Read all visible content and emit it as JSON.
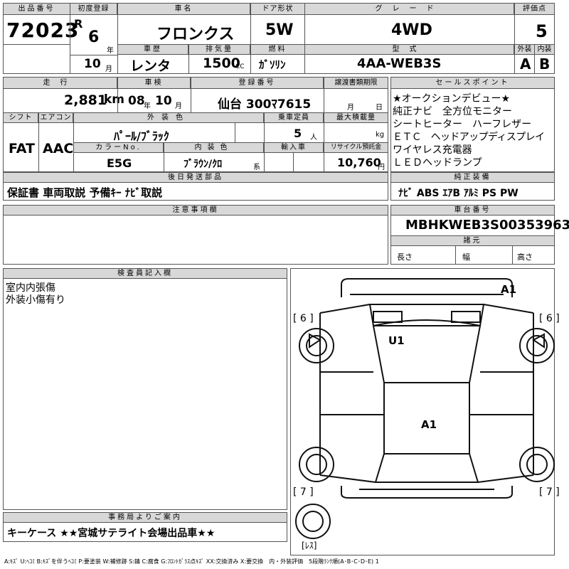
{
  "header": {
    "lot_label": "出品番号",
    "lot_value": "72023",
    "first_reg_label": "初度登録",
    "era": "R",
    "year_num": "6",
    "year_unit": "年",
    "month_num": "10",
    "month_unit": "月",
    "car_name_label": "車名",
    "car_name": "フロンクス",
    "door_label": "ドア形状",
    "door": "5W",
    "grade_label": "グレード",
    "grade": "4WD",
    "score_label": "評価点",
    "score": "5",
    "history_label": "車歴",
    "history": "レンタ",
    "displacement_label": "排気量",
    "displacement": "1500",
    "cc": "CC",
    "fuel_label": "燃料",
    "fuel": "ｶﾞｿﾘﾝ",
    "model_label": "型式",
    "model": "4AA-WEB3S",
    "exterior_label": "外装",
    "exterior": "A",
    "interior_label": "内装",
    "interior": "B"
  },
  "row2": {
    "mileage_label": "走行",
    "mileage": "2,881",
    "km": "km",
    "inspection_label": "車検",
    "insp_year": "08",
    "insp_year_unit": "年",
    "insp_month": "10",
    "insp_month_unit": "月",
    "reg_no_label": "登録番号",
    "reg_no": "仙台 300ﾏ7615",
    "transfer_label": "譲渡書類期限",
    "transfer_month_unit": "月",
    "transfer_day_unit": "日",
    "shift_label": "シフト",
    "shift": "FAT",
    "ac_label": "エアコン",
    "ac": "AAC",
    "ext_color_label": "外装色",
    "ext_color": "ﾊﾟｰﾙ/ﾌﾞﾗｯｸ",
    "capacity_label": "乗車定員",
    "capacity": "5",
    "capacity_unit": "人",
    "load_label": "最大積載量",
    "load_unit": "kg",
    "color_no_label": "カラーNo.",
    "color_no": "E5G",
    "int_color_label": "内装色",
    "int_color": "ﾌﾞﾗｳﾝ/ｸﾛ",
    "int_color_suffix": "系",
    "import_label": "輸入車",
    "recycle_label": "リサイクル預託金",
    "recycle": "10,760",
    "yen": "円"
  },
  "sales_points": {
    "label": "セールスポイント",
    "lines": [
      "★オークションデビュー★",
      "純正ナビ　全方位モニター",
      "シートヒーター　ハーフレザー",
      "ＥＴＣ　ヘッドアップディスプレイ",
      "ワイヤレス充電器",
      "ＬＥＤヘッドランプ"
    ]
  },
  "later_parts": {
    "label": "後日発送部品",
    "value": "保証書 車両取説 予備ｷｰ ﾅﾋﾞ取説"
  },
  "genuine": {
    "label": "純正装備",
    "value": "ﾅﾋﾞ ABS ｴｱB ｱﾙﾐ PS PW"
  },
  "notes": {
    "label": "注意事項欄"
  },
  "chassis": {
    "label": "車台番号",
    "value": "MBHKWEB3S00353963",
    "spec_label": "諸元",
    "length": "長さ",
    "width": "幅",
    "height": "高さ"
  },
  "inspector": {
    "label": "検査員記入欄",
    "lines": [
      "室内内張傷",
      "外装小傷有り"
    ]
  },
  "diagram": {
    "a1_top": "A1",
    "u1": "U1",
    "a1_mid": "A1",
    "tire_fl": "6",
    "tire_fr": "6",
    "tire_rl": "7",
    "tire_rr": "7",
    "spare": "ﾚｽ"
  },
  "office": {
    "label": "事務局よりご案内",
    "value": "キーケース ★★宮城サテライト会場出品車★★"
  },
  "legend": "A:ｷｽﾞ U:ﾍｺﾐ B:ｷｽﾞを伴うﾍｺﾐ P:要塗装 W:補修跡 S:錆 C:腐食 G:ﾌﾛﾝﾄｶﾞﾗｽ点ｷｽﾞ XX:交換済み X:要交換　内・外装評価　5段階ﾗﾝｸ順(A･B･C･D･E) 1"
}
